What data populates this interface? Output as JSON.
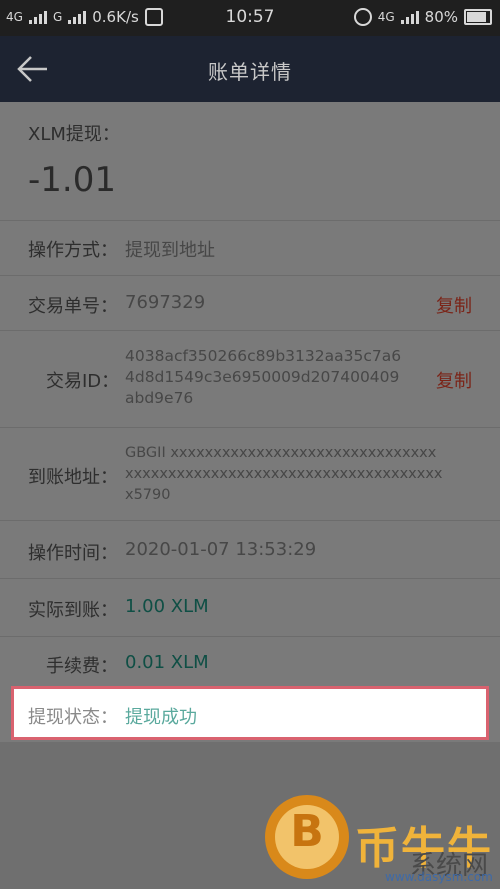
{
  "status_bar": {
    "left": {
      "sim1": "4G",
      "sim2": "G",
      "speed": "0.6K/s"
    },
    "time": "10:57",
    "right": {
      "network": "4G",
      "battery": "80%"
    },
    "icons": [
      "signal-icon",
      "notification-icon",
      "alarm-icon",
      "battery-icon"
    ]
  },
  "nav": {
    "back_icon": "back-arrow-icon",
    "title": "账单详情"
  },
  "bill": {
    "type_label": "XLM提现：",
    "amount": "-1.01",
    "rows": {
      "method": {
        "label": "操作方式：",
        "value": "提现到地址"
      },
      "order_no": {
        "label": "交易单号：",
        "value": "7697329",
        "action": "复制"
      },
      "tx_id": {
        "label": "交易ID：",
        "value_lines": [
          "4038acf350266c89b3132aa35c7a6",
          "4d8d1549c3e6950009d207400409",
          "abd9e76"
        ],
        "action": "复制"
      },
      "address": {
        "label": "到账地址：",
        "value_lines": [
          "GBGII xxxxxxxxxxxxxxxxxxxxxxxxxxxxxxx",
          "xxxxxxxxxxxxxxxxxxxxxxxxxxxxxxxxxxxxx",
          "x5790"
        ]
      },
      "time": {
        "label": "操作时间：",
        "value": "2020-01-07 13:53:29"
      },
      "received": {
        "label": "实际到账：",
        "value": "1.00 XLM"
      },
      "fee": {
        "label": "手续费：",
        "value": "0.01 XLM"
      },
      "status": {
        "label": "提现状态：",
        "value": "提现成功"
      }
    }
  },
  "colors": {
    "status_bar_bg": "#1f1f1f",
    "nav_bg": "#1d2331",
    "content_bg": "#7a7a7a",
    "copy_color": "#7b2418",
    "highlight_border": "#d9626f",
    "success_color": "#5aa99d"
  },
  "watermark": {
    "brand": "币牛牛",
    "sub": "系统网",
    "url": "www.dasysm.com"
  }
}
